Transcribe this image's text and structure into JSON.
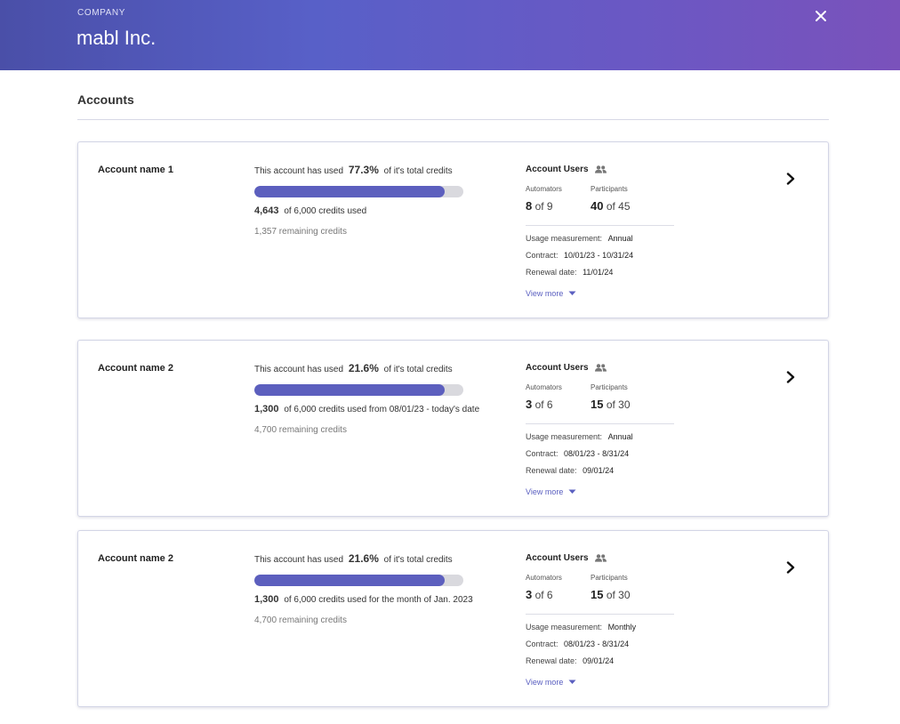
{
  "header": {
    "eyebrow": "COMPANY",
    "company_name": "mabl Inc."
  },
  "section": {
    "title": "Accounts"
  },
  "colors": {
    "accent": "#5c5fbe",
    "link": "#5a5fc0",
    "track": "#d9d9de"
  },
  "cards": [
    {
      "name": "Account name 1",
      "used_prefix": "This account has used",
      "used_pct": "77.3%",
      "used_suffix": "of it's total credits",
      "bar_fill": 0.91,
      "credits_num": "4,643",
      "credits_text": "of  6,000 credits used",
      "remaining": "1,357 remaining credits",
      "users_title": "Account Users",
      "automators_label": "Automators",
      "automators_num": "8",
      "automators_of": "of 9",
      "participants_label": "Participants",
      "participants_num": "40",
      "participants_of": "of 45",
      "usage_label": "Usage measurement:",
      "usage_value": "Annual",
      "contract_label": "Contract:",
      "contract_value": "10/01/23 - 10/31/24",
      "renewal_label": "Renewal date:",
      "renewal_value": "11/01/24",
      "view_more": "View more"
    },
    {
      "name": "Account name 2",
      "used_prefix": "This account has used",
      "used_pct": "21.6%",
      "used_suffix": "of it's total credits",
      "bar_fill": 0.91,
      "credits_num": "1,300",
      "credits_text": "of 6,000 credits used from 08/01/23 - today's date",
      "remaining": "4,700 remaining credits",
      "users_title": "Account Users",
      "automators_label": "Automators",
      "automators_num": "3",
      "automators_of": "of 6",
      "participants_label": "Participants",
      "participants_num": "15",
      "participants_of": "of 30",
      "usage_label": "Usage measurement:",
      "usage_value": "Annual",
      "contract_label": "Contract:",
      "contract_value": "08/01/23 - 8/31/24",
      "renewal_label": "Renewal date:",
      "renewal_value": "09/01/24",
      "view_more": "View more"
    },
    {
      "name": "Account name 2",
      "used_prefix": "This account has used",
      "used_pct": "21.6%",
      "used_suffix": "of it's total credits",
      "bar_fill": 0.91,
      "credits_num": "1,300",
      "credits_text": "of 6,000 credits used for the month of Jan. 2023",
      "remaining": "4,700 remaining credits",
      "users_title": "Account Users",
      "automators_label": "Automators",
      "automators_num": "3",
      "automators_of": "of 6",
      "participants_label": "Participants",
      "participants_num": "15",
      "participants_of": "of 30",
      "usage_label": "Usage measurement:",
      "usage_value": "Monthly",
      "contract_label": "Contract:",
      "contract_value": "08/01/23 - 8/31/24",
      "renewal_label": "Renewal date:",
      "renewal_value": "09/01/24",
      "view_more": "View more"
    }
  ]
}
